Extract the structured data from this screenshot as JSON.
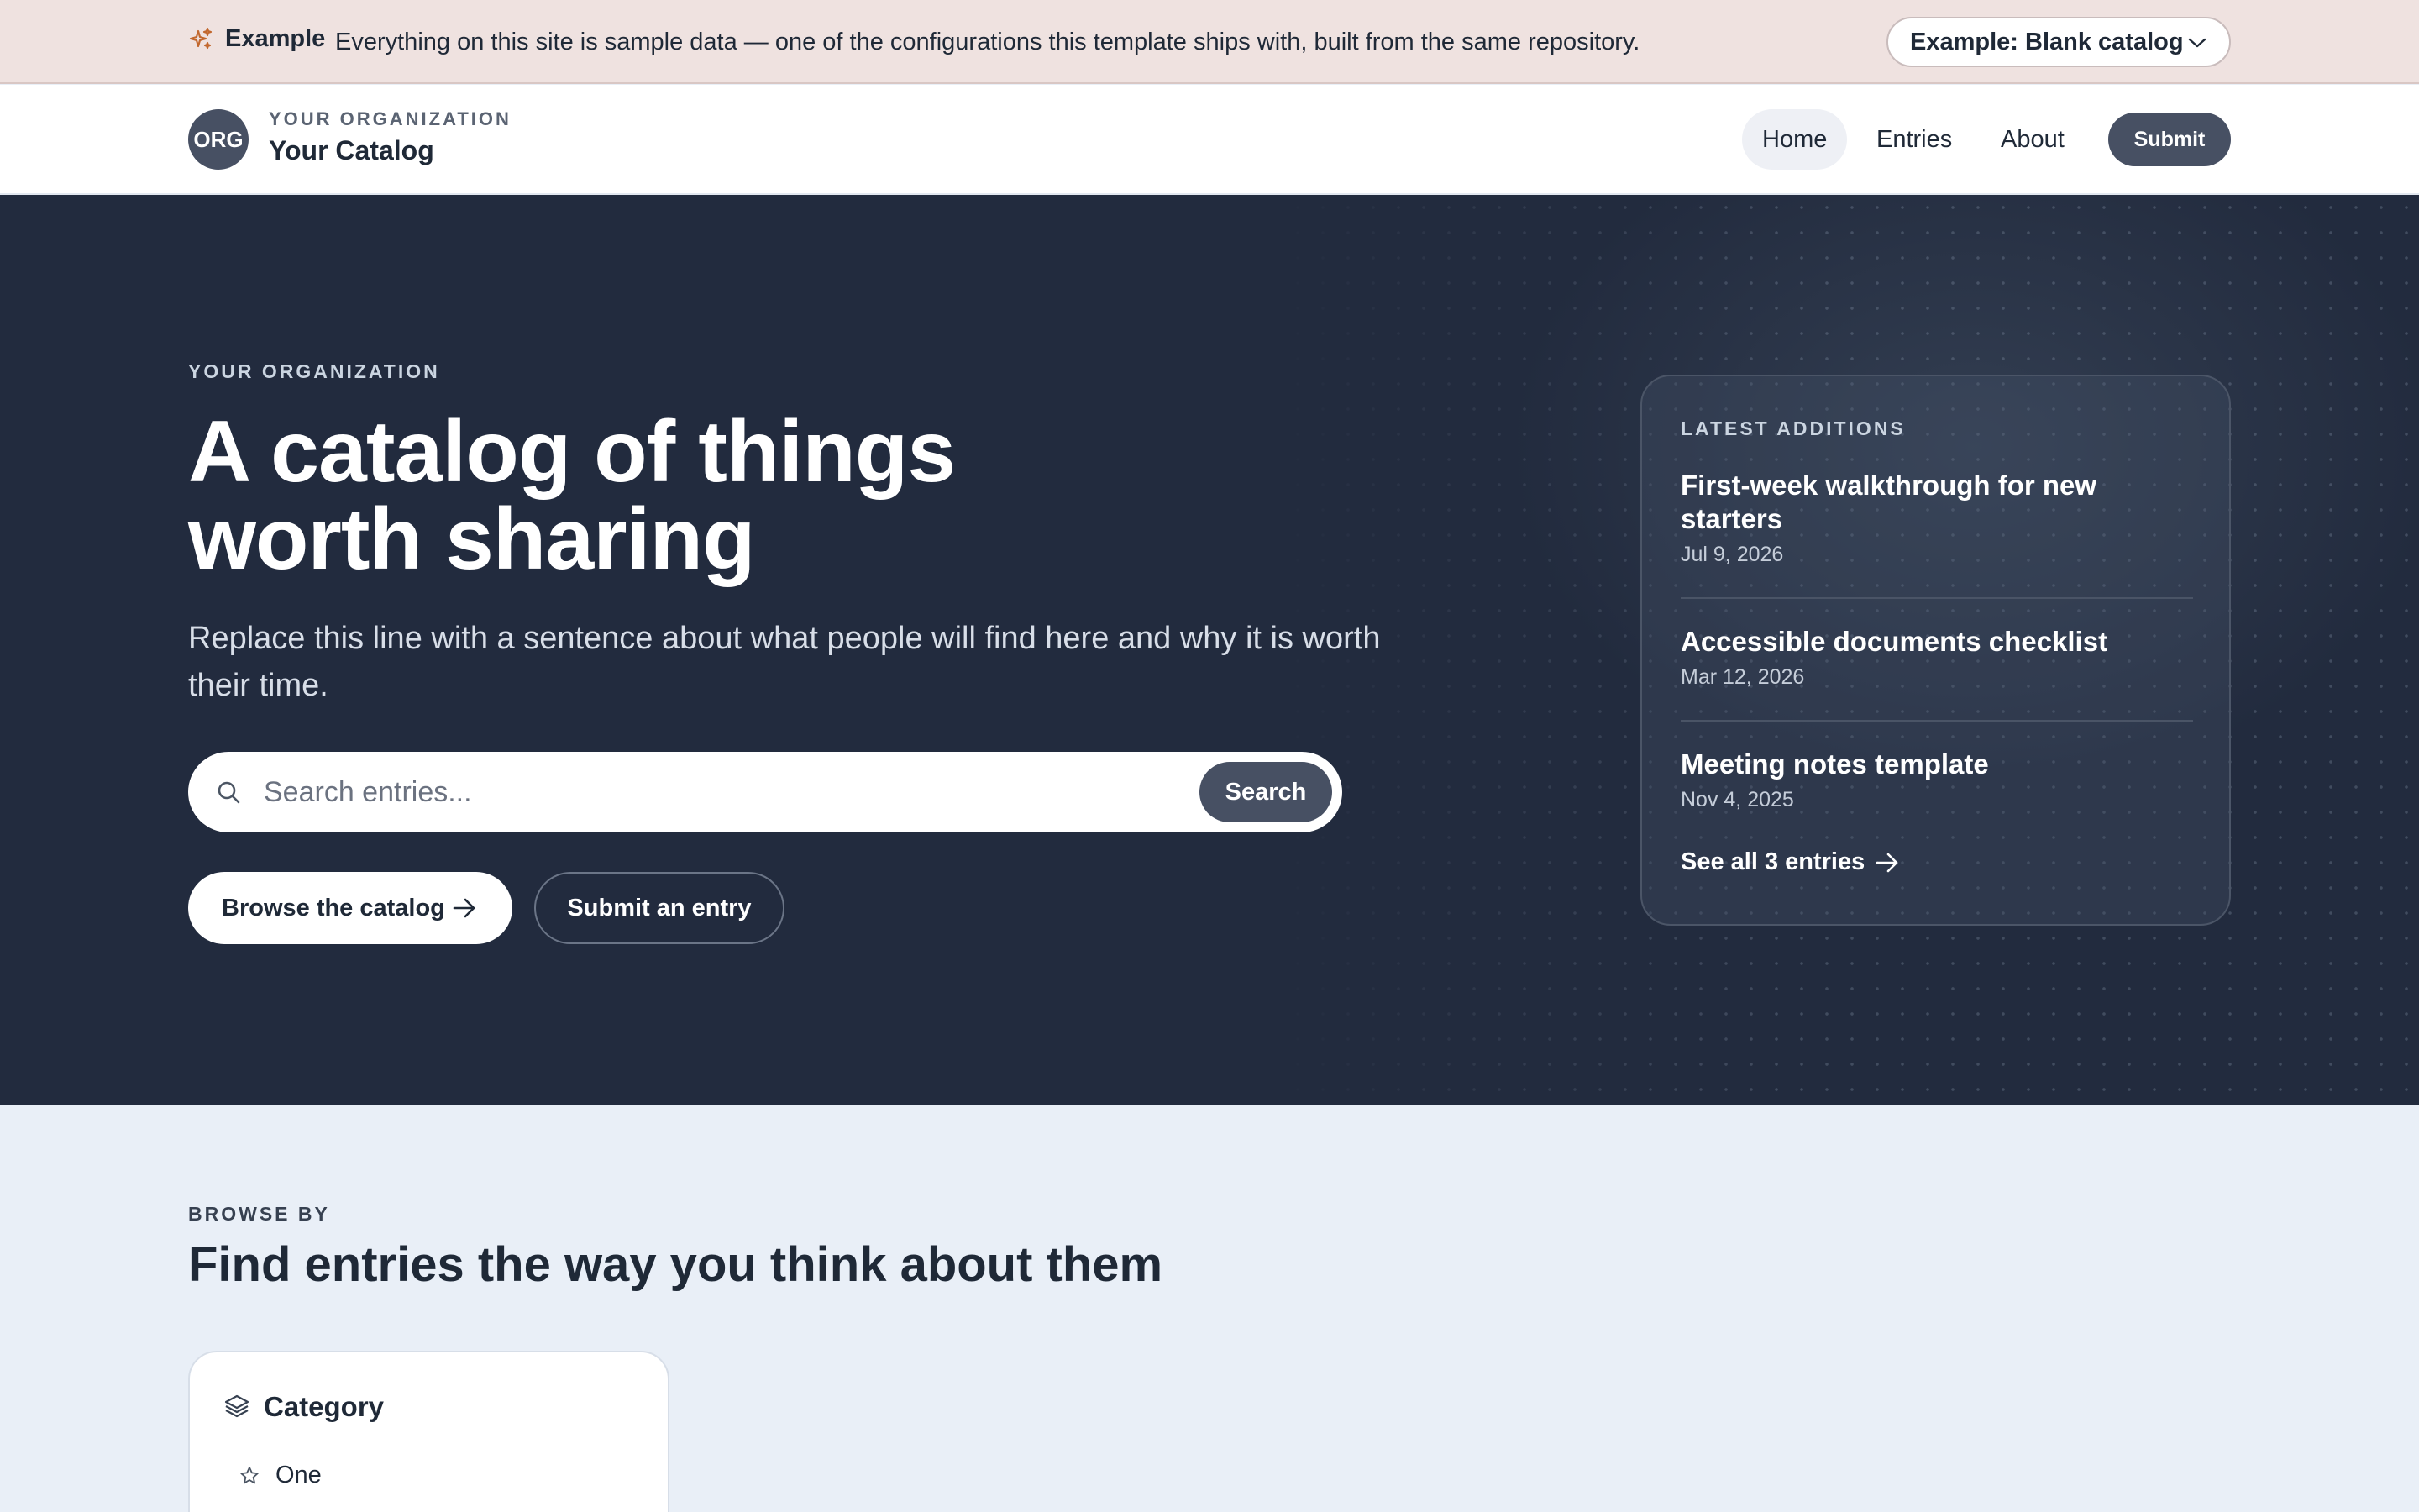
{
  "banner": {
    "tag": "Example",
    "text": "Everything on this site is sample data — one of the configurations this template ships with, built from the same repository.",
    "select_value": "Example: Blank catalog"
  },
  "header": {
    "logo_text": "ORG",
    "org_kicker": "YOUR ORGANIZATION",
    "site_name": "Your Catalog",
    "nav": [
      "Home",
      "Entries",
      "About"
    ],
    "active_nav": "Home",
    "submit_label": "Submit"
  },
  "hero": {
    "kicker": "YOUR ORGANIZATION",
    "title": "A catalog of things worth sharing",
    "subtitle": "Replace this line with a sentence about what people will find here and why it is worth their time.",
    "search_placeholder": "Search entries...",
    "search_button": "Search",
    "browse_button": "Browse the catalog",
    "submit_entry_button": "Submit an entry"
  },
  "latest": {
    "kicker": "LATEST ADDITIONS",
    "items": [
      {
        "title": "First-week walkthrough for new starters",
        "date": "Jul 9, 2026"
      },
      {
        "title": "Accessible documents checklist",
        "date": "Mar 12, 2026"
      },
      {
        "title": "Meeting notes template",
        "date": "Nov 4, 2025"
      }
    ],
    "see_all": "See all 3 entries"
  },
  "browse": {
    "kicker": "BROWSE BY",
    "title": "Find entries the way you think about them",
    "card_title": "Category",
    "card_items": [
      "One"
    ]
  },
  "colors": {
    "banner_bg": "#efe2e0",
    "hero_bg": "#222b3e",
    "accent": "#475063",
    "spark": "#c2672d",
    "page_bg": "#e9eff7"
  },
  "icons": [
    "sparkles-icon",
    "chevron-down-icon",
    "search-icon",
    "arrow-right-icon",
    "layers-icon",
    "star-icon"
  ]
}
